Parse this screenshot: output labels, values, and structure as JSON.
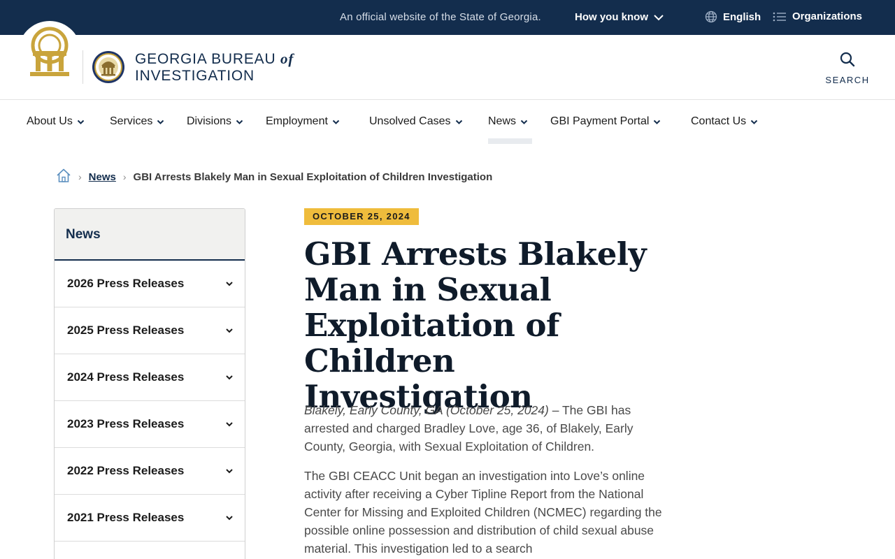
{
  "topbar": {
    "official_text": "An official website of the State of Georgia.",
    "how_you_know": "How you know",
    "language": "English",
    "organizations": "Organizations"
  },
  "header": {
    "brand_line1_prefix": "GEORGIA BUREAU ",
    "brand_line1_of": "of",
    "brand_line2": "INVESTIGATION",
    "search_label": "SEARCH"
  },
  "nav": {
    "items": [
      {
        "label": "About Us"
      },
      {
        "label": "Services"
      },
      {
        "label": "Divisions"
      },
      {
        "label": "Employment"
      },
      {
        "label": "Unsolved Cases"
      },
      {
        "label": "News"
      },
      {
        "label": "GBI Payment Portal"
      },
      {
        "label": "Contact Us"
      }
    ],
    "active": "News"
  },
  "breadcrumb": {
    "home_icon": "home-icon",
    "section": "News",
    "current": "GBI Arrests Blakely Man in Sexual Exploitation of Children Investigation"
  },
  "sidebar": {
    "heading": "News",
    "items": [
      {
        "label": "2026 Press Releases"
      },
      {
        "label": "2025 Press Releases"
      },
      {
        "label": "2024 Press Releases"
      },
      {
        "label": "2023 Press Releases"
      },
      {
        "label": "2022 Press Releases"
      },
      {
        "label": "2021 Press Releases"
      }
    ]
  },
  "article": {
    "date": "OCTOBER 25, 2024",
    "title": "GBI Arrests Blakely Man in Sexual Exploitation of Children Investigation",
    "p1_dateline": "Blakely, Early County, GA (October 25, 2024)",
    "p1_text": " – The GBI has arrested and charged Bradley Love, age 36, of Blakely, Early County, Georgia, with Sexual Exploitation of Children.",
    "p2_text": "The GBI CEACC Unit began an investigation into Love’s online activity after receiving a Cyber Tipline Report from the National Center for Missing and Exploited Children (NCMEC) regarding the possible online possession and distribution of child sexual abuse material. This investigation led to a search"
  },
  "colors": {
    "navy": "#132d4d",
    "gold": "#efbc3c",
    "seal_gold": "#c9a43c"
  }
}
